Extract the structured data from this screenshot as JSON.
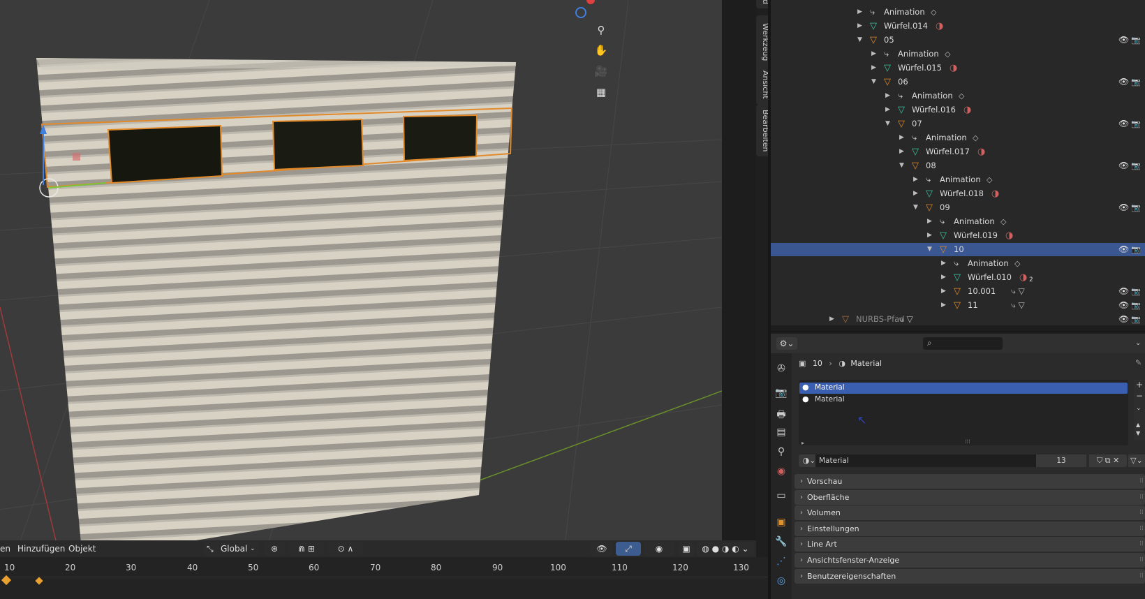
{
  "viewport": {
    "menu": [
      "en",
      "Hinzufügen",
      "Objekt"
    ],
    "transform_orientation": "Global",
    "sidebar_tabs": [
      "Werkzeug",
      "Ansicht",
      "Bearbeiten"
    ],
    "sidebar_top_tab": "d"
  },
  "timeline": {
    "ticks": [
      "10",
      "20",
      "30",
      "40",
      "50",
      "60",
      "70",
      "80",
      "90",
      "100",
      "110",
      "120",
      "130"
    ]
  },
  "outliner": {
    "rows": [
      {
        "depth": 0,
        "kind": "anim",
        "label": "Animation",
        "expanded": false
      },
      {
        "depth": 0,
        "kind": "mesh",
        "label": "Würfel.014",
        "expanded": false
      },
      {
        "depth": 0,
        "kind": "empty",
        "label": "05",
        "expanded": true,
        "visible": true
      },
      {
        "depth": 1,
        "kind": "anim",
        "label": "Animation",
        "expanded": false
      },
      {
        "depth": 1,
        "kind": "mesh",
        "label": "Würfel.015",
        "expanded": false
      },
      {
        "depth": 1,
        "kind": "empty",
        "label": "06",
        "expanded": true,
        "visible": true
      },
      {
        "depth": 2,
        "kind": "anim",
        "label": "Animation",
        "expanded": false
      },
      {
        "depth": 2,
        "kind": "mesh",
        "label": "Würfel.016",
        "expanded": false
      },
      {
        "depth": 2,
        "kind": "empty",
        "label": "07",
        "expanded": true,
        "visible": true
      },
      {
        "depth": 3,
        "kind": "anim",
        "label": "Animation",
        "expanded": false
      },
      {
        "depth": 3,
        "kind": "mesh",
        "label": "Würfel.017",
        "expanded": false
      },
      {
        "depth": 3,
        "kind": "empty",
        "label": "08",
        "expanded": true,
        "visible": true
      },
      {
        "depth": 4,
        "kind": "anim",
        "label": "Animation",
        "expanded": false
      },
      {
        "depth": 4,
        "kind": "mesh",
        "label": "Würfel.018",
        "expanded": false
      },
      {
        "depth": 4,
        "kind": "empty",
        "label": "09",
        "expanded": true,
        "visible": true
      },
      {
        "depth": 5,
        "kind": "anim",
        "label": "Animation",
        "expanded": false
      },
      {
        "depth": 5,
        "kind": "mesh",
        "label": "Würfel.019",
        "expanded": false
      },
      {
        "depth": 5,
        "kind": "empty",
        "label": "10",
        "expanded": true,
        "visible": true,
        "selected": true
      },
      {
        "depth": 6,
        "kind": "anim",
        "label": "Animation",
        "expanded": false
      },
      {
        "depth": 6,
        "kind": "mesh",
        "label": "Würfel.010",
        "expanded": false,
        "badge": "2"
      },
      {
        "depth": 6,
        "kind": "empty",
        "label": "10.001",
        "expanded": false,
        "visible": true
      },
      {
        "depth": 6,
        "kind": "empty",
        "label": "11",
        "expanded": false,
        "visible": true
      },
      {
        "depth": -2,
        "kind": "empty",
        "label": "NURBS-Pfad",
        "expanded": false,
        "visible": true,
        "dim": true
      }
    ]
  },
  "properties": {
    "breadcrumb": [
      "10",
      "Material"
    ],
    "slots": [
      "Material",
      "Material"
    ],
    "material_name": "Material",
    "user_count": "13",
    "panels": [
      "Vorschau",
      "Oberfläche",
      "Volumen",
      "Einstellungen",
      "Line Art",
      "Ansichtsfenster-Anzeige",
      "Benutzereigenschaften"
    ]
  },
  "colors": {
    "selection": "#3a5792",
    "accent_orange": "#e28a2a",
    "mesh_green": "#3ec6a0",
    "wall": "#d8d2c4"
  },
  "icons": [
    "zoom-icon",
    "hand-icon",
    "camera-icon",
    "grid-icon",
    "eye-icon",
    "camera-render-icon",
    "search-icon",
    "pin-icon"
  ]
}
